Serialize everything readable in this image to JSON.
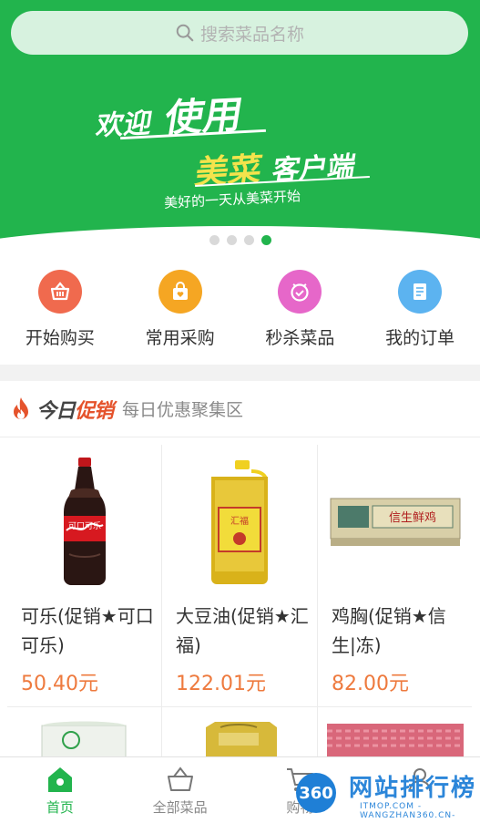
{
  "search": {
    "placeholder": "搜索菜品名称"
  },
  "banner": {
    "welcome": "欢迎",
    "use": "使用",
    "brand": "美菜",
    "client": "客户端",
    "tagline": "美好的一天从美菜开始",
    "dots": 4,
    "active_dot": 4
  },
  "quick_entries": [
    {
      "label": "开始购买",
      "icon": "basket-icon",
      "color": "#f06a4e"
    },
    {
      "label": "常用采购",
      "icon": "bag-icon",
      "color": "#f5a623"
    },
    {
      "label": "秒杀菜品",
      "icon": "clock-icon",
      "color": "#e667c9"
    },
    {
      "label": "我的订单",
      "icon": "order-list-icon",
      "color": "#5cb3f0"
    }
  ],
  "promo": {
    "title_a": "今日",
    "title_b": "促销",
    "subtitle": "每日优惠聚集区"
  },
  "products": [
    {
      "name": "可乐(促销★可口可乐)",
      "price": "50.40元",
      "image": "cola-bottle"
    },
    {
      "name": "大豆油(促销★汇福)",
      "price": "122.01元",
      "image": "oil-jug"
    },
    {
      "name": "鸡胸(促销★信生|冻)",
      "price": "82.00元",
      "image": "chicken-box"
    }
  ],
  "bottom_nav": [
    {
      "label": "首页",
      "icon": "home-icon",
      "active": true
    },
    {
      "label": "全部菜品",
      "icon": "basket-icon",
      "active": false
    },
    {
      "label": "购物",
      "icon": "cart-icon",
      "active": false
    },
    {
      "label": "",
      "icon": "user-icon",
      "active": false
    }
  ],
  "watermark": {
    "badge": "360",
    "title": "网站排行榜",
    "url": "ITMOP.COM -WANGZHAN360.CN-"
  },
  "colors": {
    "brand_green": "#22b44d",
    "price_orange": "#ee7a3e",
    "promo_red": "#e5532c"
  }
}
